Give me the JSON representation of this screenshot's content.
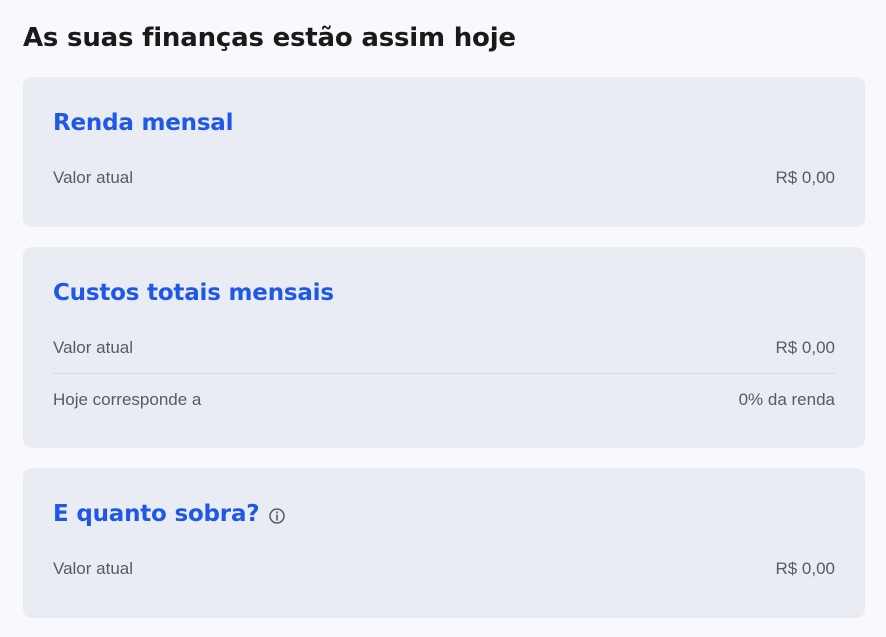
{
  "page": {
    "title": "As suas finanças estão assim hoje"
  },
  "cards": {
    "renda": {
      "title": "Renda mensal",
      "rows": [
        {
          "label": "Valor atual",
          "value": "R$ 0,00"
        }
      ]
    },
    "custos": {
      "title": "Custos totais mensais",
      "rows": [
        {
          "label": "Valor atual",
          "value": "R$ 0,00"
        },
        {
          "label": "Hoje corresponde a",
          "value": "0% da renda"
        }
      ]
    },
    "sobra": {
      "title": "E quanto sobra?",
      "info_icon": "info-icon",
      "rows": [
        {
          "label": "Valor atual",
          "value": "R$ 0,00"
        }
      ]
    }
  },
  "colors": {
    "background": "#f8f8fd",
    "card_background": "#eaecf4",
    "card_title": "#1f58e6",
    "row_text": "#555b66",
    "divider": "#d8dbe3"
  }
}
